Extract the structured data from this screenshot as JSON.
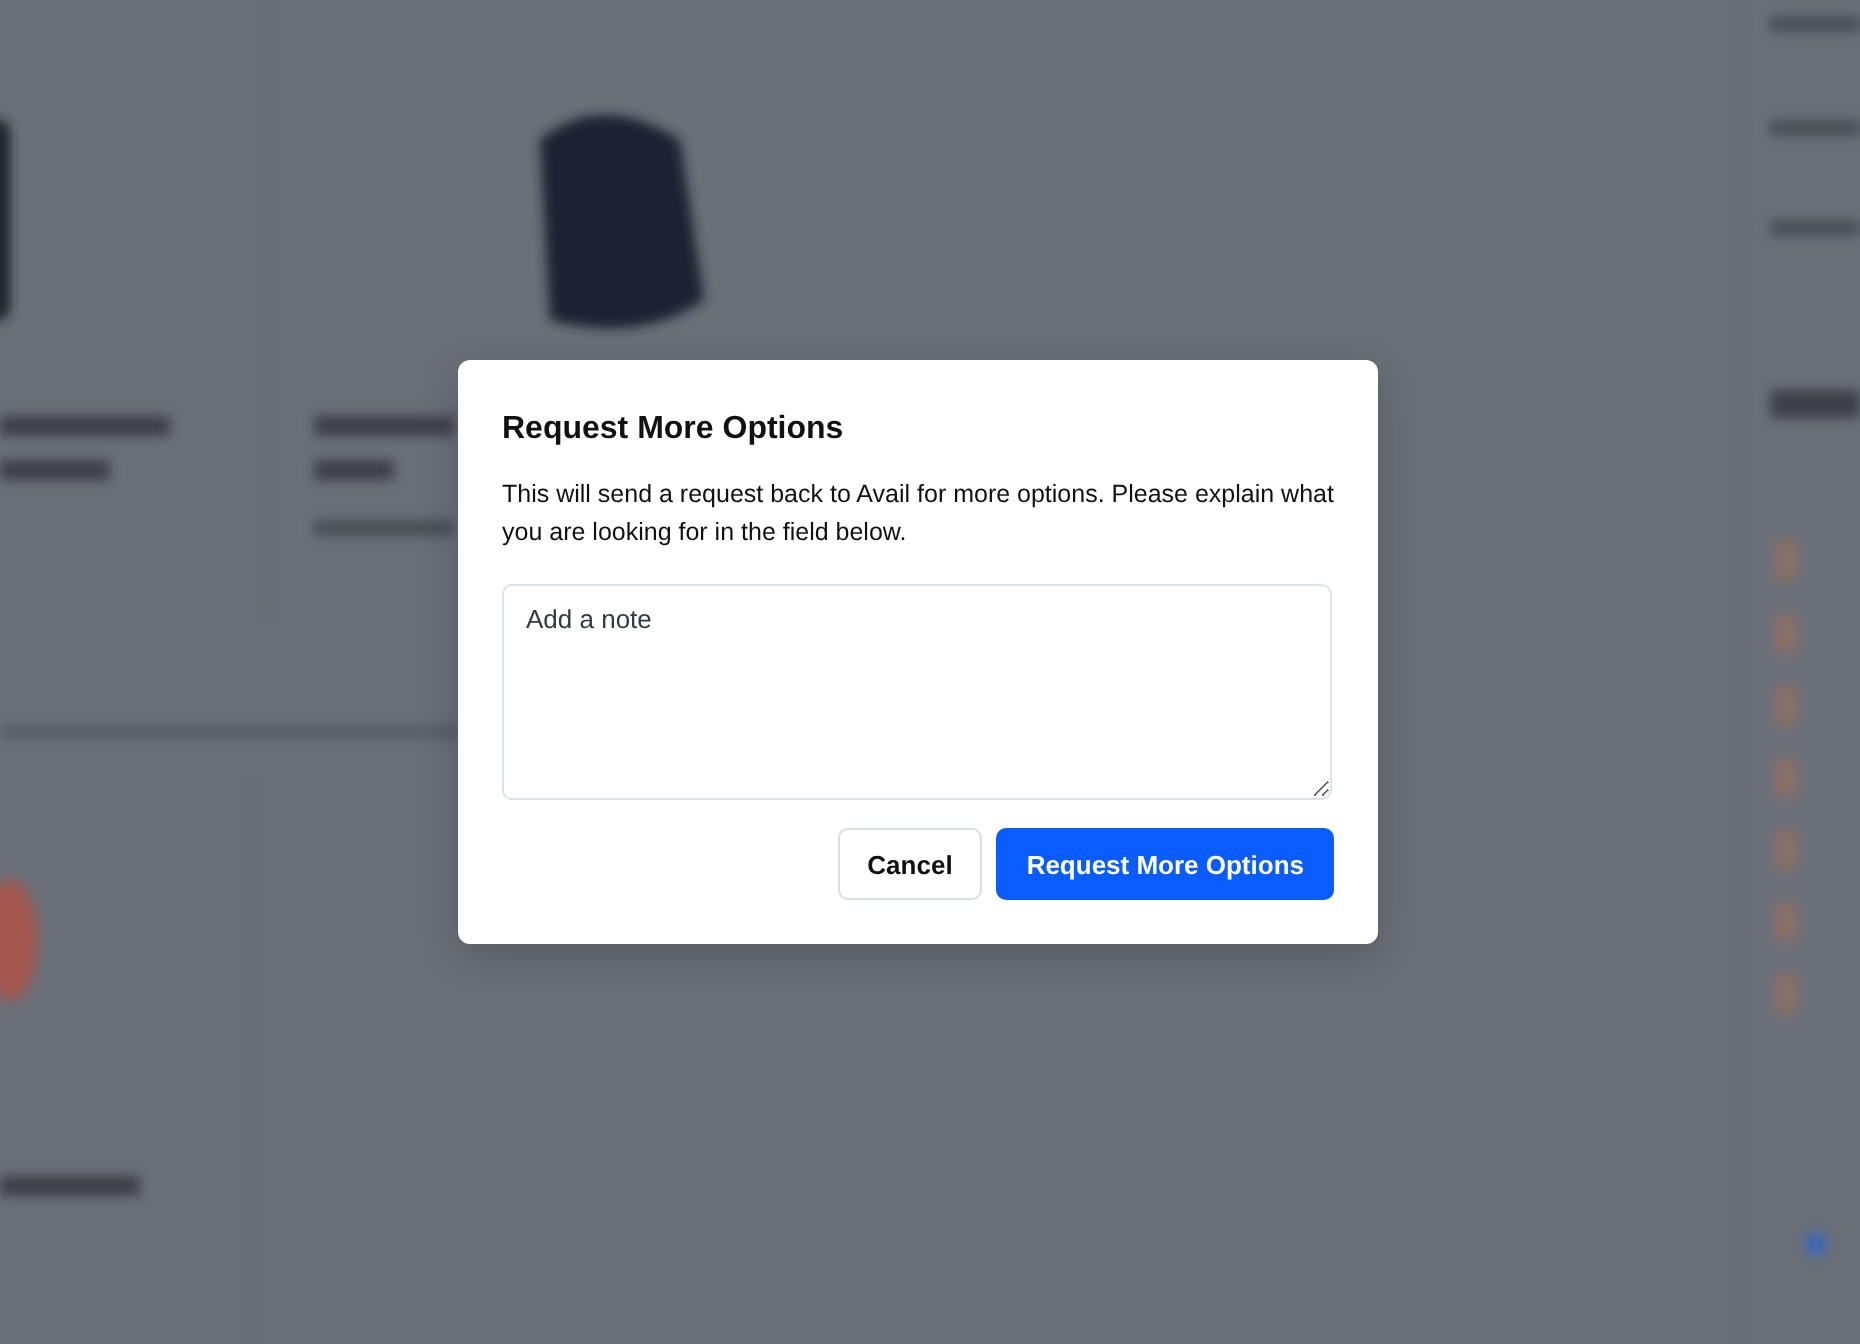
{
  "dialog": {
    "title": "Request More Options",
    "message": "This will send a request back to Avail for more options. Please explain what you are looking for in the field below.",
    "note_field": {
      "placeholder": "Add a note"
    },
    "buttons": [
      {
        "label": "Cancel",
        "kind": "secondary"
      },
      {
        "label": "Request More Options",
        "kind": "primary"
      }
    ]
  }
}
